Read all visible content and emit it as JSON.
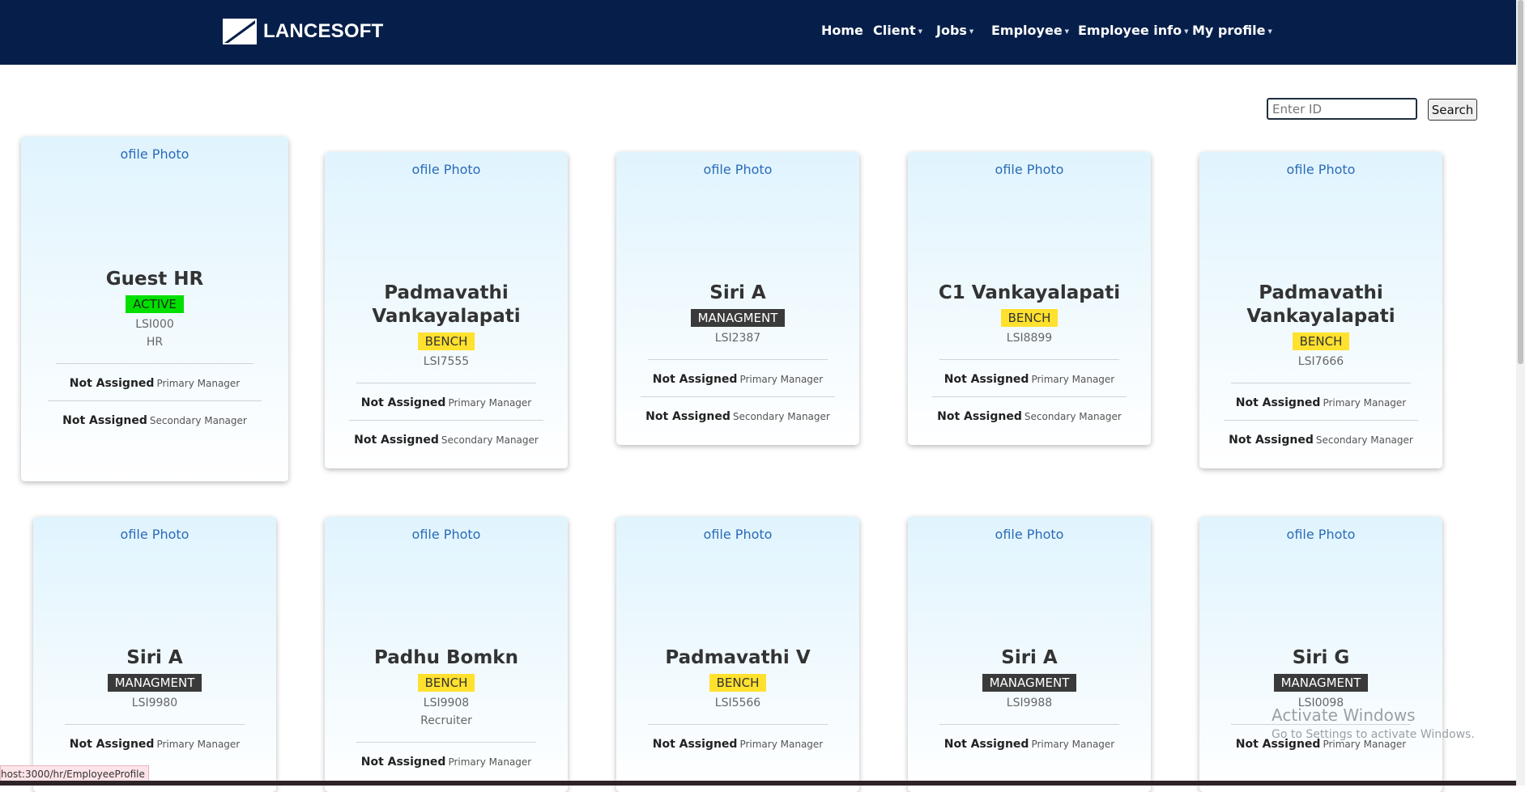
{
  "brand": {
    "name": "LANCESOFT"
  },
  "nav": {
    "items": [
      {
        "label": "Home"
      },
      {
        "label": "Client"
      },
      {
        "label": "Jobs"
      },
      {
        "label": "Employee"
      },
      {
        "label": "Employee info"
      },
      {
        "label": "My profile"
      }
    ]
  },
  "search": {
    "placeholder": "Enter ID",
    "button_label": "Search"
  },
  "photo_alt": "Profile Photo",
  "photo_alt_visible": "ofile Photo",
  "manager_labels": {
    "primary": "Primary Manager",
    "secondary": "Secondary Manager"
  },
  "cards": [
    {
      "name": "Guest HR",
      "status": "ACTIVE",
      "id": "LSI000",
      "role": "HR",
      "primary": "Not Assigned",
      "secondary": "Not Assigned"
    },
    {
      "name": "Padmavathi Vankayalapati",
      "status": "BENCH",
      "id": "LSI7555",
      "primary": "Not Assigned",
      "secondary": "Not Assigned"
    },
    {
      "name": "Siri A",
      "status": "MANAGMENT",
      "id": "LSI2387",
      "primary": "Not Assigned",
      "secondary": "Not Assigned"
    },
    {
      "name": "C1 Vankayalapati",
      "status": "BENCH",
      "id": "LSI8899",
      "primary": "Not Assigned",
      "secondary": "Not Assigned"
    },
    {
      "name": "Padmavathi Vankayalapati",
      "status": "BENCH",
      "id": "LSI7666",
      "primary": "Not Assigned",
      "secondary": "Not Assigned"
    },
    {
      "name": "Siri A",
      "status": "MANAGMENT",
      "id": "LSI9980",
      "primary": "Not Assigned"
    },
    {
      "name": "Padhu Bomkn",
      "status": "BENCH",
      "id": "LSI9908",
      "role": "Recruiter",
      "primary": "Not Assigned"
    },
    {
      "name": "Padmavathi V",
      "status": "BENCH",
      "id": "LSI5566",
      "primary": "Not Assigned"
    },
    {
      "name": "Siri A",
      "status": "MANAGMENT",
      "id": "LSI9988",
      "primary": "Not Assigned"
    },
    {
      "name": "Siri G",
      "status": "MANAGMENT",
      "id": "LSI0098",
      "primary": "Not Assigned"
    }
  ],
  "windows_watermark": {
    "title": "Activate Windows",
    "subtitle": "Go to Settings to activate Windows."
  },
  "status_link": "host:3000/hr/EmployeeProfile"
}
